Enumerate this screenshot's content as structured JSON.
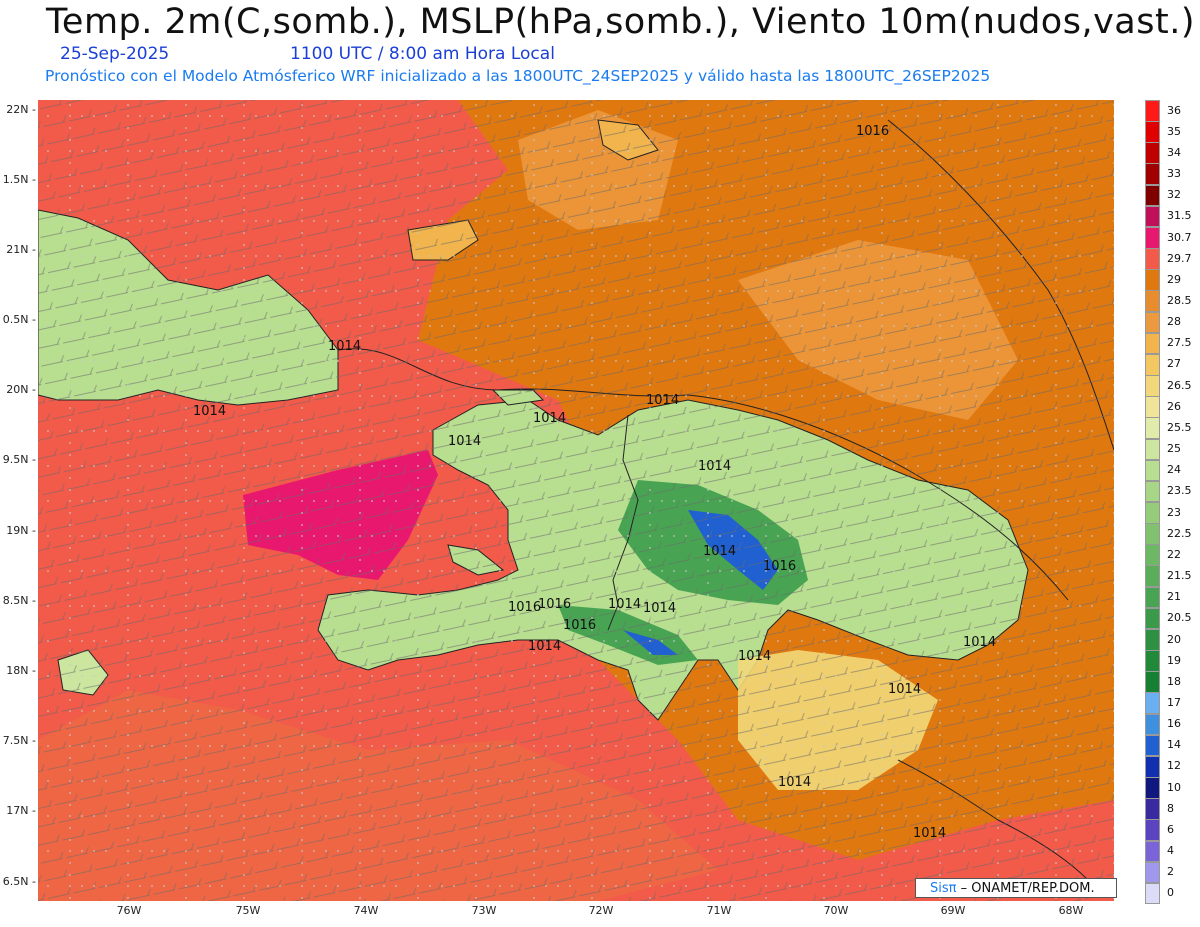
{
  "header": {
    "title": "Temp. 2m(C,somb.), MSLP(hPa,somb.), Viento 10m(nudos,vast.)",
    "date": "25-Sep-2025",
    "valid_time": "1100 UTC / 8:00 am Hora Local",
    "model_line": "Pronóstico con el Modelo Atmósferico WRF inicializado a las 1800UTC_24SEP2025 y válido hasta las   1800UTC_26SEP2025"
  },
  "axes": {
    "lat_labels": [
      "22N",
      "1.5N",
      "21N",
      "0.5N",
      "20N",
      "9.5N",
      "19N",
      "8.5N",
      "18N",
      "7.5N",
      "17N",
      "6.5N"
    ],
    "lon_labels": [
      "76W",
      "75W",
      "74W",
      "73W",
      "72W",
      "71W",
      "70W",
      "69W",
      "68W"
    ]
  },
  "isobars": [
    "1016",
    "1014",
    "1014",
    "1014",
    "1014",
    "1014",
    "1014",
    "1014",
    "1016",
    "1016",
    "1016",
    "1014",
    "1014",
    "1016",
    "1014",
    "1014",
    "1014",
    "1014",
    "1014",
    "1014"
  ],
  "colorbar": {
    "labels": [
      "36",
      "35",
      "34",
      "33",
      "32",
      "31.5",
      "30.7",
      "29.7",
      "29",
      "28.5",
      "28",
      "27.5",
      "27",
      "26.5",
      "26",
      "25.5",
      "25",
      "24",
      "23.5",
      "23",
      "22.5",
      "22",
      "21.5",
      "21",
      "20.5",
      "20",
      "19",
      "18",
      "17",
      "16",
      "14",
      "12",
      "10",
      "8",
      "6",
      "4",
      "2",
      "0"
    ],
    "colors": [
      "#ff1a1a",
      "#e00000",
      "#c00000",
      "#a00000",
      "#800000",
      "#c0105a",
      "#e8186e",
      "#f25a4a",
      "#e07810",
      "#e88c30",
      "#ec9a40",
      "#f2b44c",
      "#f4c860",
      "#f2d87a",
      "#eee49a",
      "#e2ecaa",
      "#cce6a0",
      "#b8de90",
      "#a6d686",
      "#94cc7a",
      "#80c26e",
      "#6cb864",
      "#5aae5a",
      "#48a452",
      "#3a9a4a",
      "#2e9042",
      "#22883a",
      "#188032",
      "#6ab0f0",
      "#4090e0",
      "#2060d0",
      "#1030b0",
      "#101880",
      "#3a2aa0",
      "#5a44c0",
      "#7a64d8",
      "#a098ec",
      "#dcdcf8"
    ]
  },
  "credit": {
    "brand": "Sisπ",
    "org": " – ONAMET/REP.DOM."
  }
}
